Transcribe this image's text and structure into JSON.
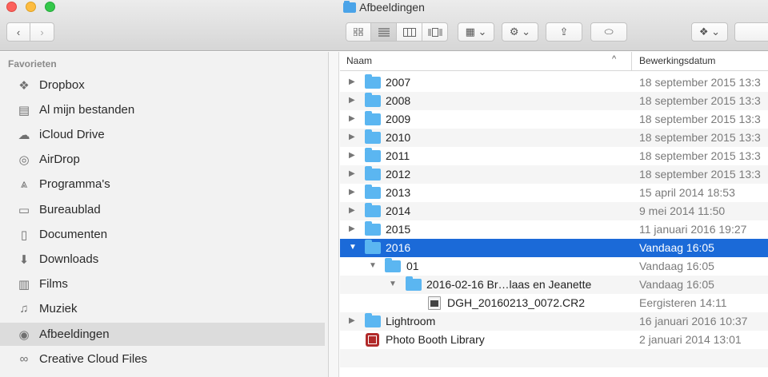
{
  "window": {
    "title": "Afbeeldingen"
  },
  "toolbar": {
    "back_label": "‹",
    "forward_label": "›",
    "view_icons": [
      "icon-view-icon",
      "list-view-icon",
      "column-view-icon",
      "cover-flow-icon"
    ],
    "arrange_label": "▦ ⌄",
    "action_label": "⚙ ⌄",
    "share_label": "⇪",
    "tag_label": "⬭",
    "dropbox_label": "❖ ⌄"
  },
  "sidebar": {
    "heading": "Favorieten",
    "items": [
      {
        "label": "Dropbox",
        "icon": "dropbox-icon",
        "glyph": "❖"
      },
      {
        "label": "Al mijn bestanden",
        "icon": "all-files-icon",
        "glyph": "▤"
      },
      {
        "label": "iCloud Drive",
        "icon": "cloud-icon",
        "glyph": "☁"
      },
      {
        "label": "AirDrop",
        "icon": "airdrop-icon",
        "glyph": "◎"
      },
      {
        "label": "Programma's",
        "icon": "applications-icon",
        "glyph": "⩓"
      },
      {
        "label": "Bureaublad",
        "icon": "desktop-icon",
        "glyph": "▭"
      },
      {
        "label": "Documenten",
        "icon": "documents-icon",
        "glyph": "▯"
      },
      {
        "label": "Downloads",
        "icon": "downloads-icon",
        "glyph": "⬇"
      },
      {
        "label": "Films",
        "icon": "films-icon",
        "glyph": "▥"
      },
      {
        "label": "Muziek",
        "icon": "music-icon",
        "glyph": "♫"
      },
      {
        "label": "Afbeeldingen",
        "icon": "pictures-icon",
        "glyph": "◉"
      },
      {
        "label": "Creative Cloud Files",
        "icon": "creative-cloud-icon",
        "glyph": "∞"
      }
    ]
  },
  "list": {
    "columns": {
      "name": "Naam",
      "date": "Bewerkingsdatum",
      "sort_indicator": "^"
    },
    "rows": [
      {
        "name": "2007",
        "date": "18 september 2015 13:3",
        "type": "folder",
        "disclosure": "▶"
      },
      {
        "name": "2008",
        "date": "18 september 2015 13:3",
        "type": "folder",
        "disclosure": "▶"
      },
      {
        "name": "2009",
        "date": "18 september 2015 13:3",
        "type": "folder",
        "disclosure": "▶"
      },
      {
        "name": "2010",
        "date": "18 september 2015 13:3",
        "type": "folder",
        "disclosure": "▶"
      },
      {
        "name": "2011",
        "date": "18 september 2015 13:3",
        "type": "folder",
        "disclosure": "▶"
      },
      {
        "name": "2012",
        "date": "18 september 2015 13:3",
        "type": "folder",
        "disclosure": "▶"
      },
      {
        "name": "2013",
        "date": "15 april 2014 18:53",
        "type": "folder",
        "disclosure": "▶"
      },
      {
        "name": "2014",
        "date": "9 mei 2014 11:50",
        "type": "folder",
        "disclosure": "▶"
      },
      {
        "name": "2015",
        "date": "11 januari 2016 19:27",
        "type": "folder",
        "disclosure": "▶"
      },
      {
        "name": "2016",
        "date": "Vandaag 16:05",
        "type": "folder",
        "disclosure": "▼"
      },
      {
        "name": "01",
        "date": "Vandaag 16:05",
        "type": "folder",
        "disclosure": "▼"
      },
      {
        "name": "2016-02-16 Br…laas en Jeanette",
        "date": "Vandaag 16:05",
        "type": "folder",
        "disclosure": "▼"
      },
      {
        "name": "DGH_20160213_0072.CR2",
        "date": "Eergisteren 14:11",
        "type": "raw-file",
        "disclosure": ""
      },
      {
        "name": "Lightroom",
        "date": "16 januari 2016 10:37",
        "type": "folder",
        "disclosure": "▶"
      },
      {
        "name": "Photo Booth Library",
        "date": "2 januari 2014 13:01",
        "type": "photobooth",
        "disclosure": ""
      }
    ]
  },
  "colors": {
    "selection": "#1b6ad8",
    "folder": "#5bb6f1"
  }
}
